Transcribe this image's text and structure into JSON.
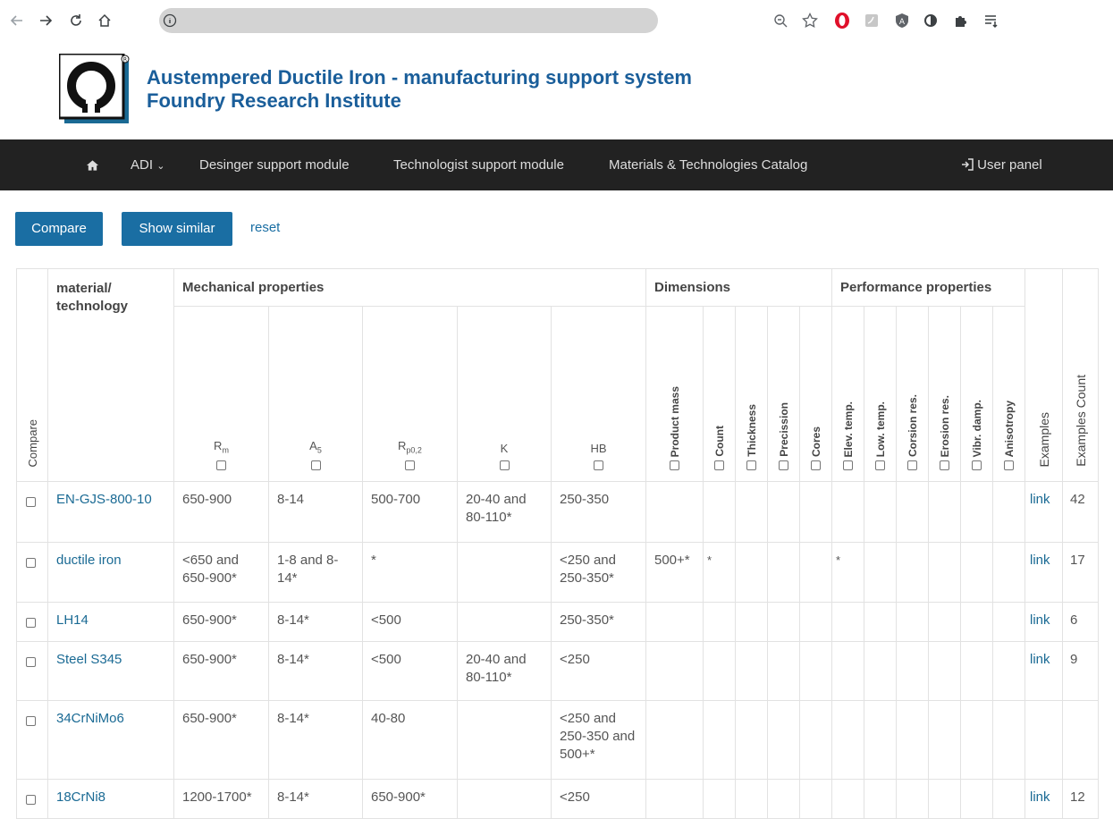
{
  "browser": {
    "icons": [
      "back-icon",
      "forward-icon",
      "reload-icon",
      "home-icon",
      "info-icon",
      "zoom-icon",
      "star-icon",
      "opera-icon",
      "pdf-icon",
      "shield-icon",
      "circle-icon",
      "puzzle-icon",
      "reading-list-icon"
    ]
  },
  "header": {
    "title_line1": "Austempered Ductile Iron - manufacturing support system",
    "title_line2": "Foundry Research Institute"
  },
  "nav": {
    "adi": "ADI",
    "designer": "Desinger support module",
    "technologist": "Technologist support module",
    "catalog": "Materials & Technologies Catalog",
    "user_panel": "User panel"
  },
  "actions": {
    "compare": "Compare",
    "show_similar": "Show similar",
    "reset": "reset"
  },
  "table": {
    "compare_header": "Compare",
    "material_header": "material/ technology",
    "group_mech": "Mechanical properties",
    "group_dims": "Dimensions",
    "group_perf": "Performance properties",
    "examples_header": "Examples",
    "examples_count_header": "Examples Count",
    "mech_cols": {
      "rm": "R",
      "rm_sub": "m",
      "a5": "A",
      "a5_sub": "5",
      "rp": "R",
      "rp_sub": "p0,2",
      "k": "K",
      "hb": "HB"
    },
    "dim_cols": [
      "Product mass",
      "Count",
      "Thickness",
      "Precission",
      "Cores"
    ],
    "perf_cols": [
      "Elev. temp.",
      "Low. temp.",
      "Corsion res.",
      "Erosion res.",
      "Vibr. damp.",
      "Anisotropy"
    ],
    "rows": [
      {
        "material": "EN-GJS-800-10",
        "rm": "650-900",
        "a5": "8-14",
        "rp": "500-700",
        "k": "20-40 and 80-110*",
        "hb": "250-350",
        "pmass": "",
        "count": "",
        "elev": "",
        "link": "link",
        "n": "42"
      },
      {
        "material": "ductile iron",
        "rm": "<650 and 650-900*",
        "a5": "1-8 and 8-14*",
        "rp": "*",
        "k": "",
        "hb": "<250 and 250-350*",
        "pmass": "500+*",
        "count": "*",
        "elev": "*",
        "link": "link",
        "n": "17"
      },
      {
        "material": "LH14",
        "rm": "650-900*",
        "a5": "8-14*",
        "rp": "<500",
        "k": "",
        "hb": "250-350*",
        "pmass": "",
        "count": "",
        "elev": "",
        "link": "link",
        "n": "6"
      },
      {
        "material": "Steel S345",
        "rm": "650-900*",
        "a5": "8-14*",
        "rp": "<500",
        "k": "20-40 and 80-110*",
        "hb": "<250",
        "pmass": "",
        "count": "",
        "elev": "",
        "link": "link",
        "n": "9"
      },
      {
        "material": "34CrNiMo6",
        "rm": "650-900*",
        "a5": "8-14*",
        "rp": "40-80",
        "k": "",
        "hb": "<250 and 250-350 and 500+*",
        "pmass": "",
        "count": "",
        "elev": "",
        "link": "",
        "n": ""
      },
      {
        "material": "18CrNi8",
        "rm": "1200-1700*",
        "a5": "8-14*",
        "rp": "650-900*",
        "k": "",
        "hb": "<250",
        "pmass": "",
        "count": "",
        "elev": "",
        "link": "link",
        "n": "12"
      }
    ]
  }
}
